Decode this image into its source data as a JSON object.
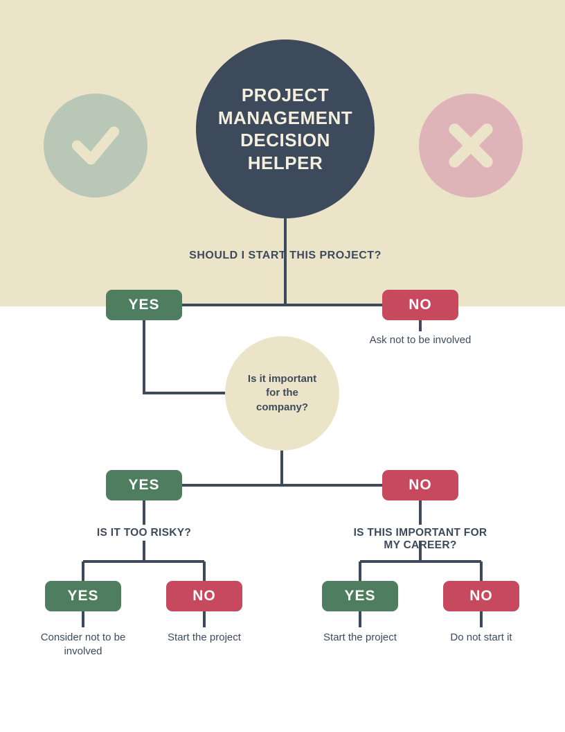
{
  "title": "PROJECT MANAGEMENT DECISION HELPER",
  "icons": {
    "check": "check-icon",
    "cross": "cross-icon"
  },
  "q1": "SHOULD I START THIS PROJECT?",
  "q1_yes": "YES",
  "q1_no": "NO",
  "q1_no_outcome": "Ask not to be involved",
  "q2": "Is it important for the company?",
  "q2_yes": "YES",
  "q2_no": "NO",
  "q3_left": "IS IT TOO RISKY?",
  "q3_left_yes": "YES",
  "q3_left_no": "NO",
  "q3_left_yes_outcome": "Consider not to be involved",
  "q3_left_no_outcome": "Start the project",
  "q3_right": "IS THIS IMPORTANT FOR MY CAREER?",
  "q3_right_yes": "YES",
  "q3_right_no": "NO",
  "q3_right_yes_outcome": "Start the project",
  "q3_right_no_outcome": "Do not start it",
  "colors": {
    "beige": "#ece4c9",
    "dark": "#3d4a5c",
    "green": "#4e7e5f",
    "red": "#c6495e",
    "checkCircle": "#b9c7b7",
    "crossCircle": "#dfb4b8",
    "iconFill": "#ece4c9"
  }
}
